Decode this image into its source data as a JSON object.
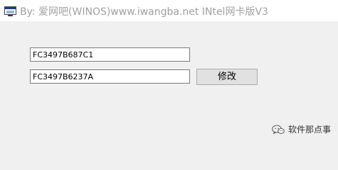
{
  "window": {
    "title": "By: 爱网吧(WINOS)www.iwangba.net INtel网卡版V3",
    "title_color": "#a0a0a0"
  },
  "form": {
    "mac_field_1": {
      "value": "FC3497B687C1"
    },
    "mac_field_2": {
      "value": "FC3497B6237A"
    },
    "modify_button_label": "修改"
  },
  "watermark": {
    "icon": "wechat-logo",
    "text": "软件那点事"
  }
}
